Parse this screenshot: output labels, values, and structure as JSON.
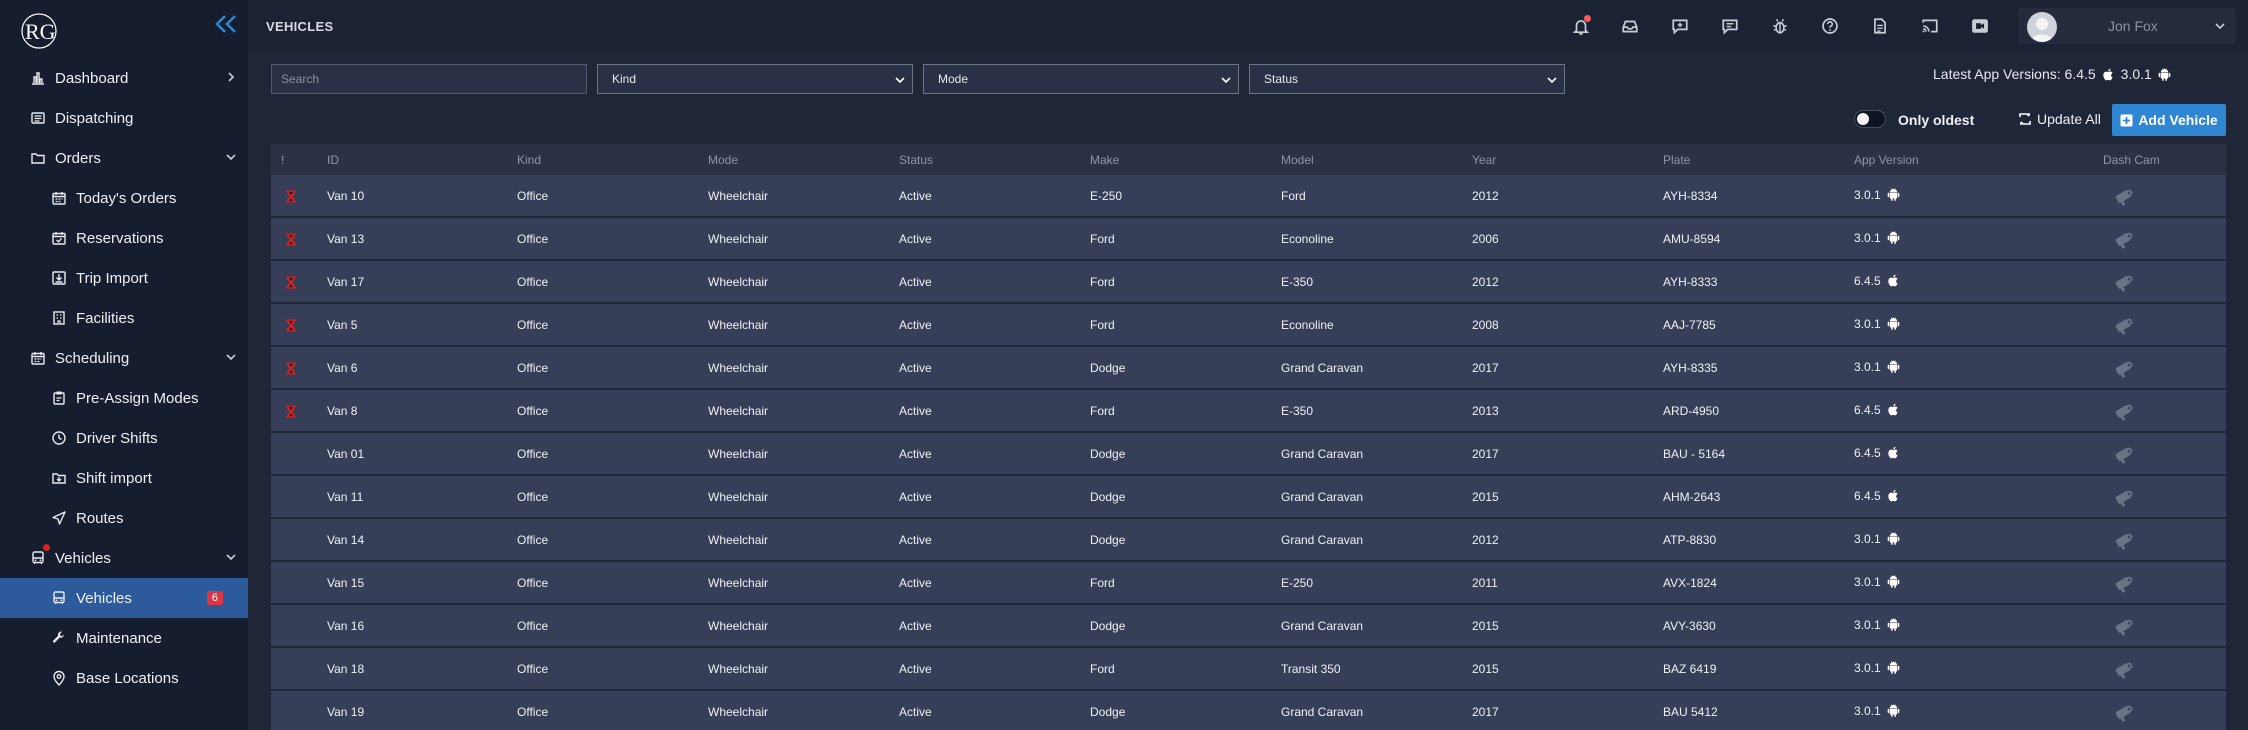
{
  "app": {
    "logo_text": "RG"
  },
  "sidebar": {
    "items": [
      {
        "label": "Dashboard",
        "icon": "chart-icon",
        "chevron": "right"
      },
      {
        "label": "Dispatching",
        "icon": "list-icon"
      },
      {
        "label": "Orders",
        "icon": "folder-icon",
        "chevron": "down"
      },
      {
        "label": "Today's Orders",
        "icon": "calendar-icon",
        "sub": true
      },
      {
        "label": "Reservations",
        "icon": "calendar-check-icon",
        "sub": true
      },
      {
        "label": "Trip Import",
        "icon": "import-icon",
        "sub": true
      },
      {
        "label": "Facilities",
        "icon": "building-icon",
        "sub": true
      },
      {
        "label": "Scheduling",
        "icon": "calendar-icon",
        "chevron": "down"
      },
      {
        "label": "Pre-Assign Modes",
        "icon": "clipboard-icon",
        "sub": true
      },
      {
        "label": "Driver Shifts",
        "icon": "clock-icon",
        "sub": true
      },
      {
        "label": "Shift import",
        "icon": "folder-import-icon",
        "sub": true
      },
      {
        "label": "Routes",
        "icon": "navigation-icon",
        "sub": true
      },
      {
        "label": "Vehicles",
        "icon": "bus-icon",
        "chevron": "down",
        "notification_dot": true
      },
      {
        "label": "Vehicles",
        "icon": "bus-icon",
        "sub": true,
        "active": true,
        "badge": "6"
      },
      {
        "label": "Maintenance",
        "icon": "wrench-icon",
        "sub": true
      },
      {
        "label": "Base Locations",
        "icon": "map-pin-icon",
        "sub": true
      }
    ]
  },
  "header": {
    "title": "VEHICLES",
    "icons": [
      "bell-icon",
      "inbox-icon",
      "chat-add-icon",
      "chat-icon",
      "bug-icon",
      "help-icon",
      "document-icon",
      "cast-icon",
      "video-camera-icon"
    ],
    "user_name": "Jon Fox"
  },
  "filters": {
    "search_placeholder": "Search",
    "kind": "Kind",
    "mode": "Mode",
    "status": "Status",
    "latest_label": "Latest App Versions: 6.4.5",
    "latest_android": "3.0.1"
  },
  "actions": {
    "only_oldest": "Only oldest",
    "update_all": "Update All",
    "add_vehicle": "Add Vehicle"
  },
  "table": {
    "columns": [
      "!",
      "ID",
      "Kind",
      "Mode",
      "Status",
      "Make",
      "Model",
      "Year",
      "Plate",
      "App Version",
      "Dash Cam"
    ],
    "rows": [
      {
        "warn": true,
        "id": "Van 10",
        "kind": "Office",
        "mode": "Wheelchair",
        "status": "Active",
        "make": "E-250",
        "model": "Ford",
        "year": "2012",
        "plate": "AYH-8334",
        "app": "3.0.1",
        "os": "android"
      },
      {
        "warn": true,
        "id": "Van 13",
        "kind": "Office",
        "mode": "Wheelchair",
        "status": "Active",
        "make": "Ford",
        "model": "Econoline",
        "year": "2006",
        "plate": "AMU-8594",
        "app": "3.0.1",
        "os": "android"
      },
      {
        "warn": true,
        "id": "Van 17",
        "kind": "Office",
        "mode": "Wheelchair",
        "status": "Active",
        "make": "Ford",
        "model": "E-350",
        "year": "2012",
        "plate": "AYH-8333",
        "app": "6.4.5",
        "os": "apple"
      },
      {
        "warn": true,
        "id": "Van 5",
        "kind": "Office",
        "mode": "Wheelchair",
        "status": "Active",
        "make": "Ford",
        "model": "Econoline",
        "year": "2008",
        "plate": "AAJ-7785",
        "app": "3.0.1",
        "os": "android"
      },
      {
        "warn": true,
        "id": "Van 6",
        "kind": "Office",
        "mode": "Wheelchair",
        "status": "Active",
        "make": "Dodge",
        "model": "Grand Caravan",
        "year": "2017",
        "plate": "AYH-8335",
        "app": "3.0.1",
        "os": "android"
      },
      {
        "warn": true,
        "id": "Van 8",
        "kind": "Office",
        "mode": "Wheelchair",
        "status": "Active",
        "make": "Ford",
        "model": "E-350",
        "year": "2013",
        "plate": "ARD-4950",
        "app": "6.4.5",
        "os": "apple"
      },
      {
        "warn": false,
        "id": "Van 01",
        "kind": "Office",
        "mode": "Wheelchair",
        "status": "Active",
        "make": "Dodge",
        "model": "Grand Caravan",
        "year": "2017",
        "plate": "BAU - 5164",
        "app": "6.4.5",
        "os": "apple"
      },
      {
        "warn": false,
        "id": "Van 11",
        "kind": "Office",
        "mode": "Wheelchair",
        "status": "Active",
        "make": "Dodge",
        "model": "Grand Caravan",
        "year": "2015",
        "plate": "AHM-2643",
        "app": "6.4.5",
        "os": "apple"
      },
      {
        "warn": false,
        "id": "Van 14",
        "kind": "Office",
        "mode": "Wheelchair",
        "status": "Active",
        "make": "Dodge",
        "model": "Grand Caravan",
        "year": "2012",
        "plate": "ATP-8830",
        "app": "3.0.1",
        "os": "android"
      },
      {
        "warn": false,
        "id": "Van 15",
        "kind": "Office",
        "mode": "Wheelchair",
        "status": "Active",
        "make": "Ford",
        "model": "E-250",
        "year": "2011",
        "plate": "AVX-1824",
        "app": "3.0.1",
        "os": "android"
      },
      {
        "warn": false,
        "id": "Van 16",
        "kind": "Office",
        "mode": "Wheelchair",
        "status": "Active",
        "make": "Dodge",
        "model": "Grand Caravan",
        "year": "2015",
        "plate": "AVY-3630",
        "app": "3.0.1",
        "os": "android"
      },
      {
        "warn": false,
        "id": "Van 18",
        "kind": "Office",
        "mode": "Wheelchair",
        "status": "Active",
        "make": "Ford",
        "model": "Transit 350",
        "year": "2015",
        "plate": "BAZ 6419",
        "app": "3.0.1",
        "os": "android"
      },
      {
        "warn": false,
        "id": "Van 19",
        "kind": "Office",
        "mode": "Wheelchair",
        "status": "Active",
        "make": "Dodge",
        "model": "Grand Caravan",
        "year": "2017",
        "plate": "BAU 5412",
        "app": "3.0.1",
        "os": "android"
      }
    ]
  },
  "colors": {
    "accent": "#2f86d3",
    "active_nav": "#2d5a9a",
    "warning": "#e02020",
    "row_bg": "#373e58"
  }
}
